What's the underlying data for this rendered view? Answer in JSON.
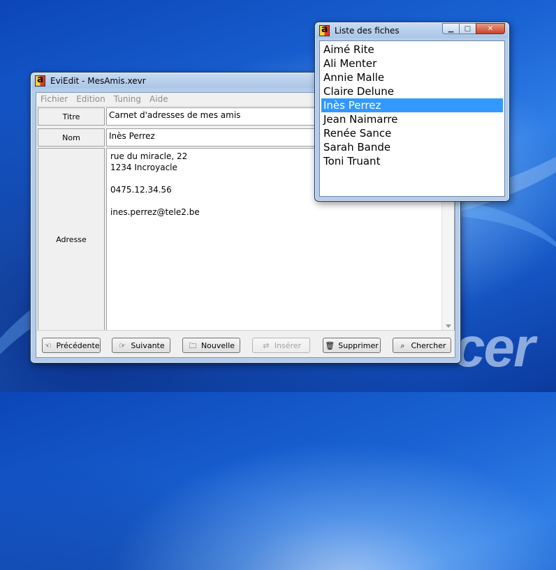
{
  "main_window": {
    "title": "EviEdit - MesAmis.xevr",
    "menu": [
      "Fichier",
      "Edition",
      "Tuning",
      "Aide"
    ],
    "fields": {
      "titre_label": "Titre",
      "titre_value": "Carnet d'adresses de mes amis",
      "nom_label": "Nom",
      "nom_value": "Inès Perrez",
      "adresse_label": "Adresse",
      "adresse_lines": [
        "rue du miracle, 22",
        "1234 Incroyacle",
        "",
        "0475.12.34.56",
        "",
        "ines.perrez@tele2.be"
      ]
    },
    "buttons": {
      "precedente": "Précédente",
      "suivante": "Suivante",
      "nouvelle": "Nouvelle",
      "inserer": "Insérer",
      "supprimer": "Supprimer",
      "chercher": "Chercher"
    }
  },
  "list_window": {
    "title": "Liste des fiches",
    "items": [
      "Aimé Rite",
      "Ali Menter",
      "Annie Malle",
      "Claire Delune",
      "Inès Perrez",
      "Jean Naimarre",
      "Renée Sance",
      "Sarah Bande",
      "Toni Truant"
    ],
    "selected": "Inès Perrez"
  },
  "desktop": {
    "logo_text": "cer"
  },
  "colors": {
    "selection": "#3399ff",
    "disabled_text": "#a0a0a0"
  }
}
